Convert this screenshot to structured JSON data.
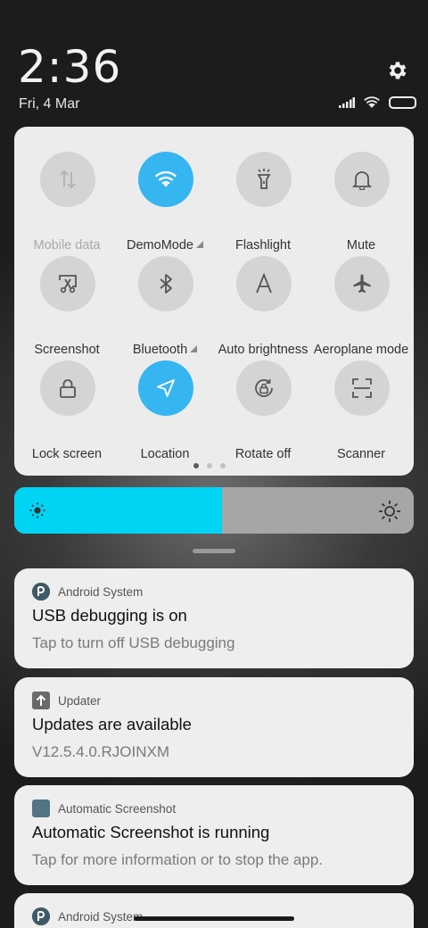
{
  "status": {
    "time": "2:36",
    "date": "Fri, 4 Mar",
    "icons": [
      "signal-icon",
      "wifi-icon",
      "battery-icon"
    ]
  },
  "quick_settings": {
    "tiles": [
      {
        "label": "Mobile data",
        "icon": "mobile-data-icon",
        "active": false,
        "disabled": true
      },
      {
        "label": "DemoMode",
        "icon": "wifi-icon",
        "active": true,
        "expandable": true
      },
      {
        "label": "Flashlight",
        "icon": "flashlight-icon",
        "active": false
      },
      {
        "label": "Mute",
        "icon": "bell-icon",
        "active": false
      },
      {
        "label": "Screenshot",
        "icon": "screenshot-icon",
        "active": false
      },
      {
        "label": "Bluetooth",
        "icon": "bluetooth-icon",
        "active": false,
        "expandable": true
      },
      {
        "label": "Auto brightness",
        "icon": "auto-brightness-icon",
        "active": false
      },
      {
        "label": "Aeroplane mode",
        "icon": "airplane-icon",
        "active": false
      },
      {
        "label": "Lock screen",
        "icon": "lock-icon",
        "active": false
      },
      {
        "label": "Location",
        "icon": "location-icon",
        "active": true
      },
      {
        "label": "Rotate off",
        "icon": "rotate-lock-icon",
        "active": false
      },
      {
        "label": "Scanner",
        "icon": "scanner-icon",
        "active": false
      }
    ],
    "page_count": 3,
    "current_page": 1,
    "accent_color": "#36b6f1"
  },
  "brightness": {
    "level": 0.52,
    "fill_color": "#00d4f5"
  },
  "notifications": [
    {
      "app": "Android System",
      "title": "USB debugging is on",
      "body": "Tap to turn off USB debugging",
      "icon": "android-system-icon"
    },
    {
      "app": "Updater",
      "title": "Updates are available",
      "body": "V12.5.4.0.RJOINXM",
      "icon": "updater-arrow-icon"
    },
    {
      "app": "Automatic Screenshot",
      "title": "Automatic Screenshot is running",
      "body": "Tap for more information or to stop the app.",
      "icon": "automatic-screenshot-icon"
    },
    {
      "app": "Android System",
      "title": "",
      "body": "",
      "icon": "android-system-icon"
    }
  ]
}
